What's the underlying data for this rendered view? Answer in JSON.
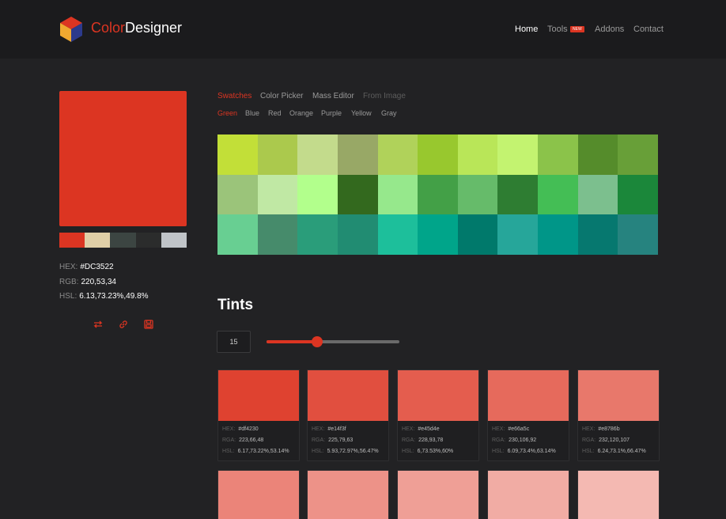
{
  "header": {
    "brand_part1": "Color",
    "brand_part2": "Designer",
    "nav": [
      {
        "label": "Home",
        "active": true
      },
      {
        "label": "Tools",
        "badge": "NEW"
      },
      {
        "label": "Addons"
      },
      {
        "label": "Contact"
      }
    ]
  },
  "selected": {
    "color": "#dc3522",
    "hex_label": "HEX:",
    "hex": "#DC3522",
    "rgb_label": "RGB:",
    "rgb": "220,53,34",
    "hsl_label": "HSL:",
    "hsl": "6.13,73.23%,49.8%",
    "mini_colors": [
      "#dc3522",
      "#e0cfa7",
      "#3c4542",
      "#2b2c2c",
      "#c0c4c8"
    ]
  },
  "actions": [
    "swap-icon",
    "link-icon",
    "save-icon"
  ],
  "tabs": [
    "Swatches",
    "Color Picker",
    "Mass Editor",
    "From Image"
  ],
  "filters": [
    "Green",
    "Blue",
    "Red",
    "Orange",
    "Purple",
    "Yellow",
    "Gray"
  ],
  "swatches": [
    [
      "#c2df38",
      "#abc94d",
      "#c3db8c",
      "#98a866",
      "#b0d25a",
      "#98c82e",
      "#b9e658",
      "#c3f370",
      "#8bc34a",
      "#558c2b",
      "#689f38"
    ],
    [
      "#9bc47a",
      "#c0e8a4",
      "#b2ff8c",
      "#33691e",
      "#96e88c",
      "#43a047",
      "#66bb6a",
      "#2e7d32",
      "#44be55",
      "#7cbf8e",
      "#1b873a"
    ],
    [
      "#68cf92",
      "#468b6b",
      "#2a9d7a",
      "#218c72",
      "#1dbf9b",
      "#00a58a",
      "#00796b",
      "#26a69a",
      "#009688",
      "#06786f",
      "#26837f"
    ]
  ],
  "tints": {
    "title": "Tints",
    "count": "15",
    "slider_fraction": 0.38,
    "cards": [
      {
        "color": "#df4230",
        "hex": "#df4230",
        "rga": "223,66,48",
        "hsl": "6.17,73.22%,53.14%"
      },
      {
        "color": "#e14f3f",
        "hex": "#e14f3f",
        "rga": "225,79,63",
        "hsl": "5.93,72.97%,56.47%"
      },
      {
        "color": "#e45d4e",
        "hex": "#e45d4e",
        "rga": "228,93,78",
        "hsl": "6,73.53%,60%"
      },
      {
        "color": "#e66a5c",
        "hex": "#e66a5c",
        "rga": "230,106,92",
        "hsl": "6.09,73.4%,63.14%"
      },
      {
        "color": "#e8786b",
        "hex": "#e8786b",
        "rga": "232,120,107",
        "hsl": "6.24,73.1%,66.47%"
      }
    ],
    "second_row_colors": [
      "#eb8479",
      "#ed9288",
      "#ef9f96",
      "#f1aca4",
      "#f4b9b2"
    ],
    "labels": {
      "hex": "HEX:",
      "rga": "RGA:",
      "hsl": "HSL:"
    }
  }
}
